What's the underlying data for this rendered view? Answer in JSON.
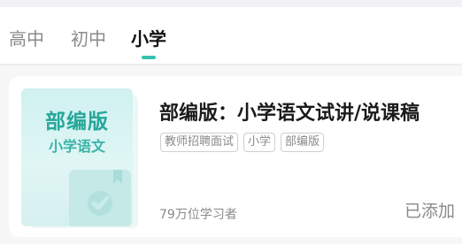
{
  "tabs": [
    {
      "label": "高中",
      "active": false
    },
    {
      "label": "初中",
      "active": false
    },
    {
      "label": "小学",
      "active": true
    }
  ],
  "course": {
    "cover": {
      "title": "部编版",
      "subtitle": "小学语文",
      "icon": "check-icon"
    },
    "title": "部编版：小学语文试讲/说课稿",
    "tags": [
      "教师招聘面试",
      "小学",
      "部编版"
    ],
    "learners": "79万位学习者",
    "status": "已添加"
  },
  "colors": {
    "accent": "#35c0b2",
    "cover_text": "#27a79a",
    "muted_text": "#8a8a8a"
  }
}
